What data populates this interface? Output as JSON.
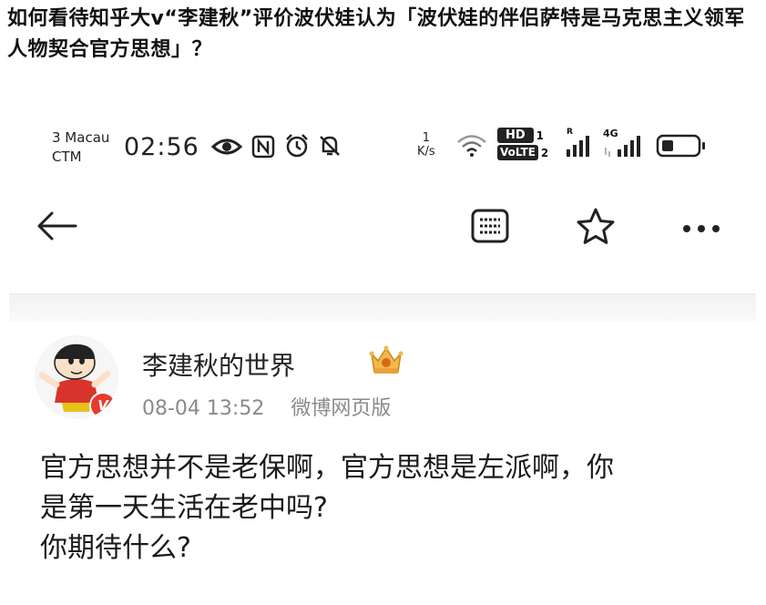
{
  "question": {
    "title": "如何看待知乎大v“李建秋”评价波伏娃认为「波伏娃的伴侣萨特是马克思主义领军人物契合官方思想」？"
  },
  "status_bar": {
    "carrier_line1": "3 Macau",
    "carrier_line2": "CTM",
    "time": "02:56",
    "net_speed_value": "1",
    "net_speed_unit": "K/s",
    "hd_label": "HD",
    "hd_sim": "1",
    "volte_label": "VoLTE",
    "volte_sim": "2",
    "roaming_label": "R",
    "network_label": "4G",
    "icons": [
      "eye-comfort-icon",
      "nfc-icon",
      "alarm-icon",
      "mute-icon",
      "wifi-icon",
      "signal-icon",
      "battery-icon"
    ]
  },
  "toolbar": {
    "icons": [
      "back-arrow-icon",
      "reader-mode-icon",
      "star-icon",
      "more-icon"
    ]
  },
  "post": {
    "author": "李建秋的世界",
    "time": "08-04 13:52",
    "source": "微博网页版",
    "badge_text": "V",
    "lines": [
      "官方思想并不是老保啊，官方思想是左派啊，你",
      "是第一天生活在老中吗?",
      "你期待什么?"
    ]
  },
  "colors": {
    "verified_red": "#e8392a",
    "crown_gold": "#e9a23b",
    "meta_gray": "#8a8a8a"
  }
}
